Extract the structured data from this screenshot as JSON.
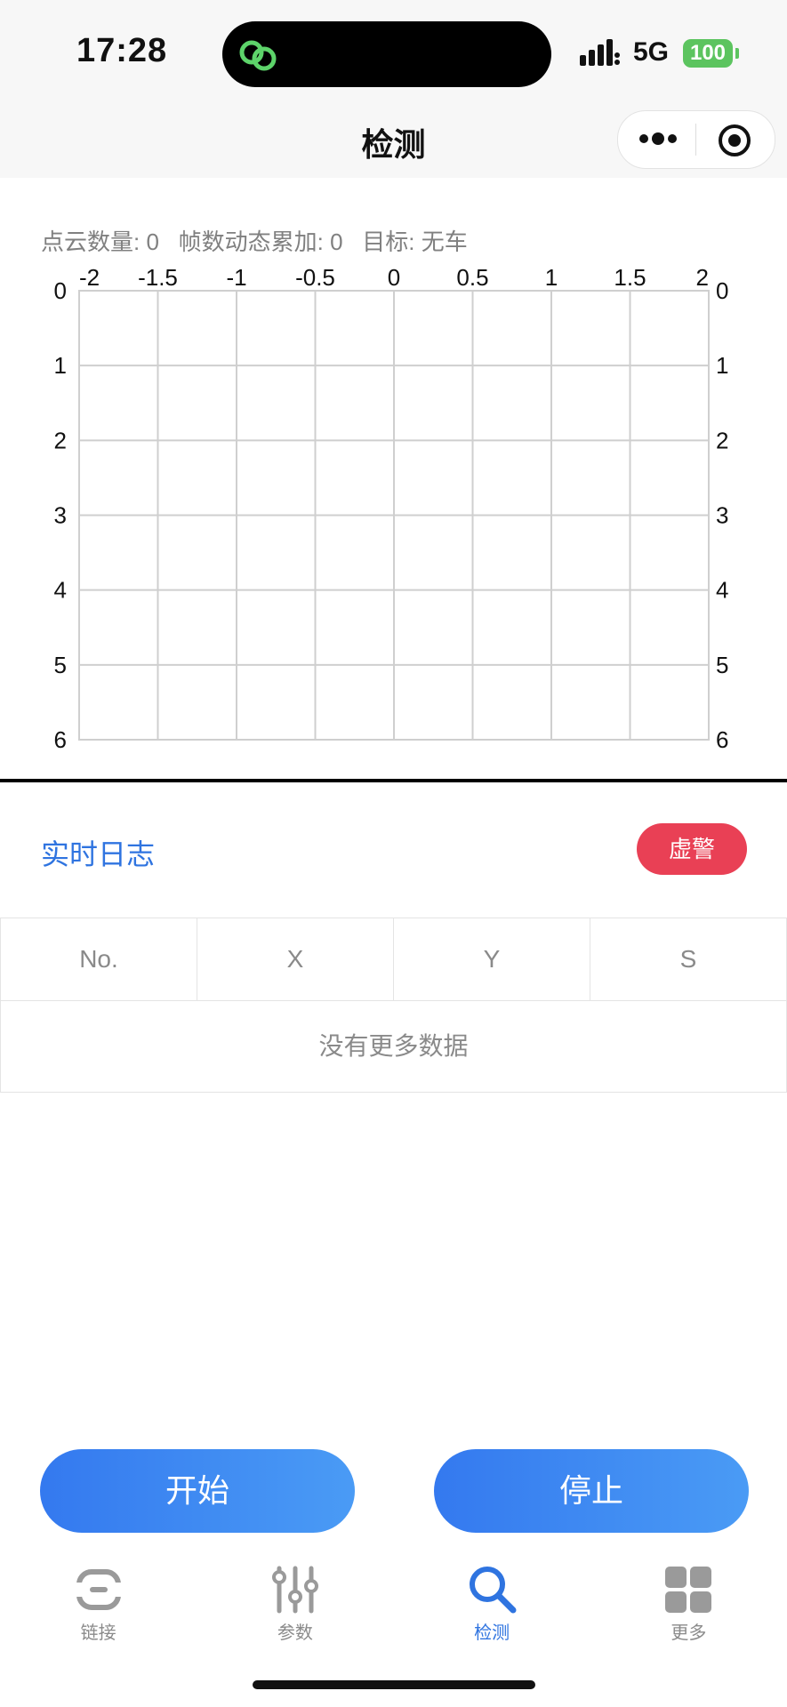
{
  "status_bar": {
    "time": "17:28",
    "network": "5G",
    "battery": "100"
  },
  "nav": {
    "title": "检测"
  },
  "stats": {
    "point_count_label": "点云数量:",
    "point_count": "0",
    "frames_label": "帧数动态累加:",
    "frames": "0",
    "target_label": "目标:",
    "target": "无车"
  },
  "chart_data": {
    "type": "scatter",
    "title": "",
    "xlabel": "",
    "ylabel": "",
    "x_ticks": [
      "-2",
      "-1.5",
      "-1",
      "-0.5",
      "0",
      "0.5",
      "1",
      "1.5",
      "2"
    ],
    "y_ticks": [
      "0",
      "1",
      "2",
      "3",
      "4",
      "5",
      "6"
    ],
    "xlim": [
      -2,
      2
    ],
    "ylim": [
      0,
      6
    ],
    "y_inverted": true,
    "grid": true,
    "points": []
  },
  "log": {
    "title": "实时日志",
    "alarm_button": "虚警"
  },
  "table": {
    "headers": [
      "No.",
      "X",
      "Y",
      "S"
    ],
    "empty_text": "没有更多数据"
  },
  "actions": {
    "start": "开始",
    "stop": "停止"
  },
  "tabbar": {
    "items": [
      {
        "label": "链接",
        "icon": "link-icon"
      },
      {
        "label": "参数",
        "icon": "sliders-icon"
      },
      {
        "label": "检测",
        "icon": "search-icon",
        "active": true
      },
      {
        "label": "更多",
        "icon": "grid-icon"
      }
    ]
  },
  "colors": {
    "accent": "#2f74e0",
    "alarm": "#e94055",
    "battery": "#5cc45f",
    "button_gradient_start": "#3479ef",
    "button_gradient_end": "#4a9bf5"
  }
}
